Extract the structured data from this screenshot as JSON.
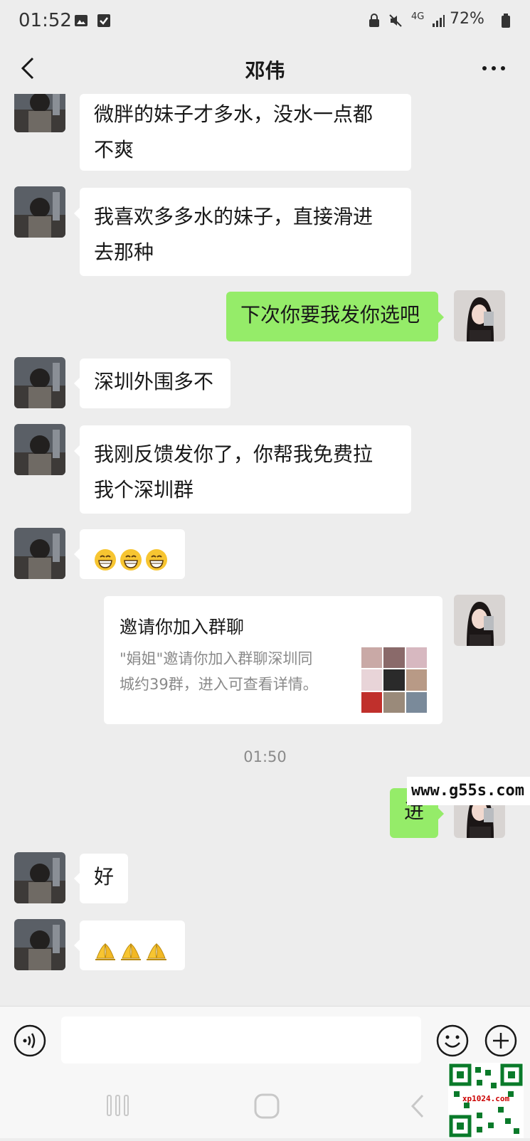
{
  "status_bar": {
    "time": "01:52",
    "network": "4G",
    "battery": "72%"
  },
  "header": {
    "title": "邓伟"
  },
  "messages": [
    {
      "side": "left",
      "text_lines": [
        "微胖的妹子才多水，没水一点都",
        "不爽"
      ]
    },
    {
      "side": "left",
      "text_lines": [
        "我喜欢多多水的妹子，直接滑进",
        "去那种"
      ]
    },
    {
      "side": "right",
      "text_lines": [
        "下次你要我发你选吧"
      ]
    },
    {
      "side": "left",
      "text_lines": [
        "深圳外围多不"
      ]
    },
    {
      "side": "left",
      "text_lines": [
        "我刚反馈发你了，你帮我免费拉",
        "我个深圳群"
      ]
    },
    {
      "side": "left",
      "emoji": "grin-emoji",
      "emoji_count": 3
    },
    {
      "side": "right",
      "card": {
        "title": "邀请你加入群聊",
        "desc_lines": [
          "\"娟姐\"邀请你加入群聊深圳同",
          "城约39群，进入可查看详情。"
        ]
      }
    },
    {
      "side": "right",
      "text_lines": [
        "进"
      ]
    },
    {
      "side": "left",
      "text_lines": [
        "好"
      ]
    },
    {
      "side": "left",
      "emoji": "pray-emoji",
      "emoji_count": 3
    }
  ],
  "timestamp": "01:50",
  "watermark": "www.g55s.com",
  "qr_watermark": "xp1024.com",
  "colors": {
    "background": "#ededed",
    "bubble_incoming": "#ffffff",
    "bubble_outgoing": "#95ec69",
    "meta_text": "#8a8a8a"
  },
  "icons": {
    "back": "chevron-left-icon",
    "more": "more-dots-icon",
    "voice": "voice-icon",
    "emoji": "smiley-icon",
    "plus": "plus-circle-icon"
  }
}
